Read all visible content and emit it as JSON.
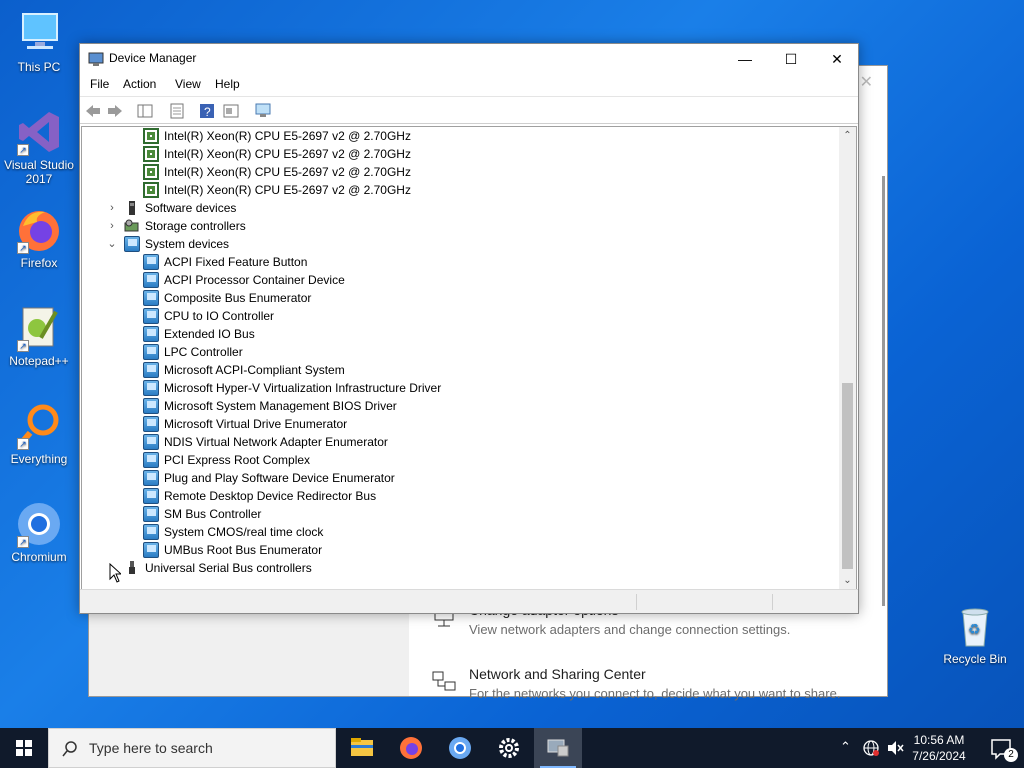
{
  "desktop": {
    "icons": [
      {
        "label": "This PC"
      },
      {
        "label": "Visual Studio 2017"
      },
      {
        "label": "Firefox"
      },
      {
        "label": "Notepad++"
      },
      {
        "label": "Everything"
      },
      {
        "label": "Chromium"
      },
      {
        "label": "Recycle Bin"
      }
    ]
  },
  "background_window": {
    "items": [
      {
        "title": "Change adapter options",
        "desc": "View network adapters and change connection settings."
      },
      {
        "title": "Network and Sharing Center",
        "desc": "For the networks you connect to, decide what you want to share."
      }
    ]
  },
  "device_manager": {
    "title": "Device Manager",
    "window_controls": {
      "minimize": "—",
      "maximize": "☐",
      "close": "✕"
    },
    "menu": [
      "File",
      "Action",
      "View",
      "Help"
    ],
    "tree": {
      "processors": [
        "Intel(R) Xeon(R) CPU E5-2697 v2 @ 2.70GHz",
        "Intel(R) Xeon(R) CPU E5-2697 v2 @ 2.70GHz",
        "Intel(R) Xeon(R) CPU E5-2697 v2 @ 2.70GHz",
        "Intel(R) Xeon(R) CPU E5-2697 v2 @ 2.70GHz"
      ],
      "software_devices": "Software devices",
      "storage_controllers": "Storage controllers",
      "system_devices": "System devices",
      "system_children": [
        "ACPI Fixed Feature Button",
        "ACPI Processor Container Device",
        "Composite Bus Enumerator",
        "CPU to IO Controller",
        "Extended IO Bus",
        "LPC Controller",
        "Microsoft ACPI-Compliant System",
        "Microsoft Hyper-V Virtualization Infrastructure Driver",
        "Microsoft System Management BIOS Driver",
        "Microsoft Virtual Drive Enumerator",
        "NDIS Virtual Network Adapter Enumerator",
        "PCI Express Root Complex",
        "Plug and Play Software Device Enumerator",
        "Remote Desktop Device Redirector Bus",
        "SM Bus Controller",
        "System CMOS/real time clock",
        "UMBus Root Bus Enumerator"
      ],
      "usb_controllers": "Universal Serial Bus controllers"
    }
  },
  "taskbar": {
    "search_placeholder": "Type here to search",
    "time": "10:56 AM",
    "date": "7/26/2024",
    "notification_count": "2"
  }
}
